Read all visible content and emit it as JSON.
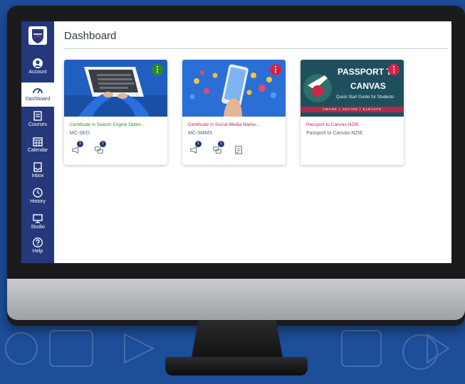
{
  "colors": {
    "nav_bg": "#25387b",
    "seo": "#2e8b22",
    "smms": "#d0254a",
    "nzie": "#d0254a",
    "bg": "#1d4e9a"
  },
  "nav": {
    "items": [
      {
        "label": "Account",
        "icon": "account-icon"
      },
      {
        "label": "Dashboard",
        "icon": "dashboard-icon",
        "active": true
      },
      {
        "label": "Courses",
        "icon": "courses-icon"
      },
      {
        "label": "Calendar",
        "icon": "calendar-icon"
      },
      {
        "label": "Inbox",
        "icon": "inbox-icon"
      },
      {
        "label": "History",
        "icon": "history-icon"
      },
      {
        "label": "Studio",
        "icon": "studio-icon"
      },
      {
        "label": "Help",
        "icon": "help-icon"
      }
    ]
  },
  "page": {
    "title": "Dashboard"
  },
  "cards": [
    {
      "name": "Certificate in Search Engine Optim...",
      "code": "MC-SEO",
      "color": "#2e8b22",
      "badges": [
        "1",
        "1"
      ]
    },
    {
      "name": "Certificate in Social Media Marke...",
      "code": "MC-SMMS",
      "color": "#d0254a",
      "badges": [
        "1",
        "1"
      ]
    },
    {
      "name": "Passport to Canvas-NZIE",
      "code": "Passport to Canvas-NZIE",
      "color": "#d0254a",
      "banner_title": "PASSPORT TO",
      "banner_title2": "CANVAS",
      "banner_sub": "Quick Start Guide for Students",
      "banner_strip": "AWARE | ADVISE | ELEVATE"
    }
  ]
}
